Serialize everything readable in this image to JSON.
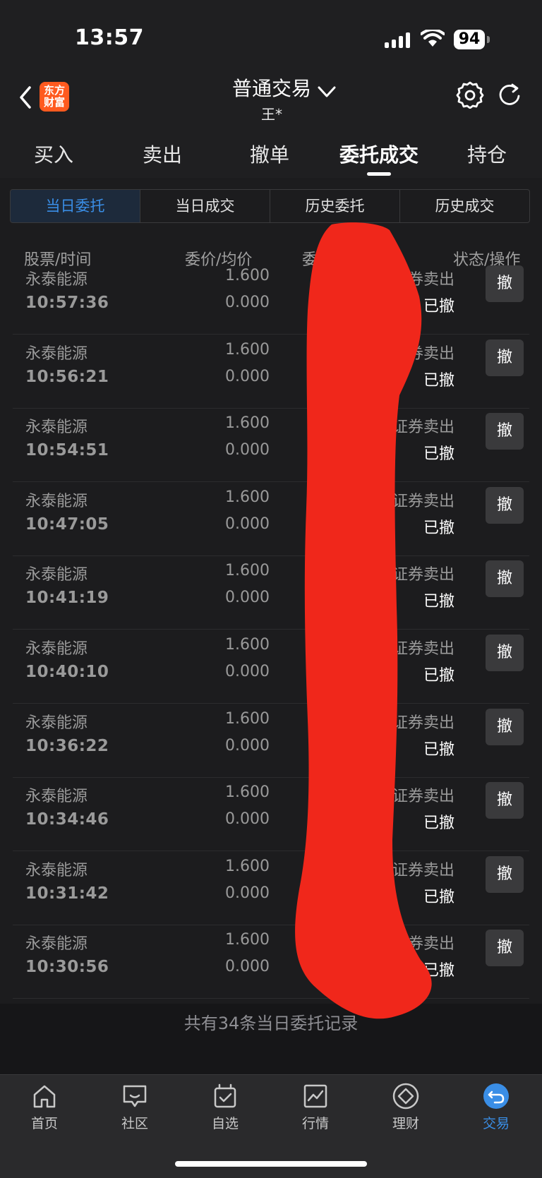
{
  "status": {
    "time": "13:57",
    "battery": "94"
  },
  "header": {
    "title": "普通交易",
    "account": "王*",
    "logo_line1": "东方",
    "logo_line2": "财富"
  },
  "tabs": [
    {
      "label": "买入"
    },
    {
      "label": "卖出"
    },
    {
      "label": "撤单"
    },
    {
      "label": "委托成交"
    },
    {
      "label": "持仓"
    }
  ],
  "subtabs": [
    {
      "label": "当日委托"
    },
    {
      "label": "当日成交"
    },
    {
      "label": "历史委托"
    },
    {
      "label": "历史成交"
    }
  ],
  "columns": {
    "stock_time": "股票/时间",
    "price_avg": "委价/均价",
    "qty": "委量/成交",
    "status_op": "状态/操作"
  },
  "orders": [
    {
      "name": "永泰能源",
      "time": "10:57:36",
      "price": "1.600",
      "avg": "0.000",
      "type": "证券卖出",
      "state": "已撤",
      "action": "撤"
    },
    {
      "name": "永泰能源",
      "time": "10:56:21",
      "price": "1.600",
      "avg": "0.000",
      "type": "证券卖出",
      "state": "已撤",
      "action": "撤"
    },
    {
      "name": "永泰能源",
      "time": "10:54:51",
      "price": "1.600",
      "avg": "0.000",
      "type": "证券卖出",
      "state": "已撤",
      "action": "撤"
    },
    {
      "name": "永泰能源",
      "time": "10:47:05",
      "price": "1.600",
      "avg": "0.000",
      "type": "证券卖出",
      "state": "已撤",
      "action": "撤"
    },
    {
      "name": "永泰能源",
      "time": "10:41:19",
      "price": "1.600",
      "avg": "0.000",
      "type": "证券卖出",
      "state": "已撤",
      "action": "撤"
    },
    {
      "name": "永泰能源",
      "time": "10:40:10",
      "price": "1.600",
      "avg": "0.000",
      "type": "证券卖出",
      "state": "已撤",
      "action": "撤"
    },
    {
      "name": "永泰能源",
      "time": "10:36:22",
      "price": "1.600",
      "avg": "0.000",
      "type": "证券卖出",
      "state": "已撤",
      "action": "撤"
    },
    {
      "name": "永泰能源",
      "time": "10:34:46",
      "price": "1.600",
      "avg": "0.000",
      "type": "证券卖出",
      "state": "已撤",
      "action": "撤"
    },
    {
      "name": "永泰能源",
      "time": "10:31:42",
      "price": "1.600",
      "avg": "0.000",
      "type": "证券卖出",
      "state": "已撤",
      "action": "撤"
    },
    {
      "name": "永泰能源",
      "time": "10:30:56",
      "price": "1.600",
      "avg": "0.000",
      "type": "证券卖出",
      "state": "已撤",
      "action": "撤"
    }
  ],
  "footer": {
    "count_text": "共有34条当日委托记录"
  },
  "bottom_nav": [
    {
      "label": "首页",
      "icon": "home-icon"
    },
    {
      "label": "社区",
      "icon": "chat-icon"
    },
    {
      "label": "自选",
      "icon": "watchlist-icon"
    },
    {
      "label": "行情",
      "icon": "chart-icon"
    },
    {
      "label": "理财",
      "icon": "diamond-icon"
    },
    {
      "label": "交易",
      "icon": "trade-icon"
    }
  ],
  "colors": {
    "accent": "#3a8ee6",
    "logo": "#ff5a1f",
    "redaction": "#f0271b"
  }
}
